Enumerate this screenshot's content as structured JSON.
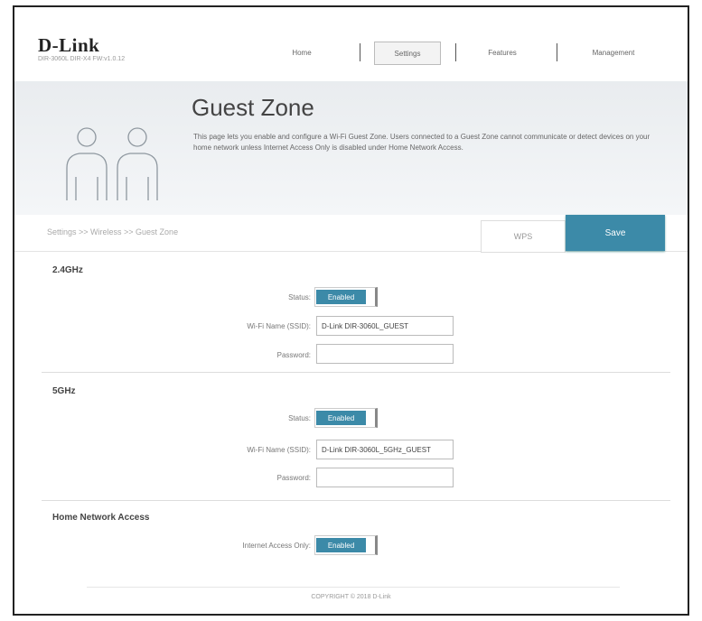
{
  "header": {
    "logo": "D-Link",
    "model": "DIR-3060L   DIR-X4   FW:v1.0.12",
    "nav": {
      "home": "Home",
      "settings": "Settings",
      "features": "Features",
      "management": "Management"
    }
  },
  "hero": {
    "title": "Guest Zone",
    "description": "This page lets you enable and configure a Wi-Fi Guest Zone. Users connected to a Guest Zone cannot communicate or detect devices on your home network unless Internet Access Only is disabled under Home Network Access."
  },
  "breadcrumb": "Settings >> Wireless >> Guest Zone",
  "buttons": {
    "wps": "WPS",
    "save": "Save"
  },
  "band24": {
    "title": "2.4GHz",
    "status_label": "Status:",
    "status_value": "Enabled",
    "ssid_label": "Wi-Fi Name (SSID):",
    "ssid_value": "D-Link DIR-3060L_GUEST",
    "password_label": "Password:",
    "password_value": ""
  },
  "band5": {
    "title": "5GHz",
    "status_label": "Status:",
    "status_value": "Enabled",
    "ssid_label": "Wi-Fi Name (SSID):",
    "ssid_value": "D-Link DIR-3060L_5GHz_GUEST",
    "password_label": "Password:",
    "password_value": ""
  },
  "home_network": {
    "title": "Home Network Access",
    "internet_only_label": "Internet Access Only:",
    "internet_only_value": "Enabled"
  },
  "footer": "COPYRIGHT © 2018 D-Link",
  "colors": {
    "accent": "#3c8aa8",
    "hero_bg": "#eceff2"
  }
}
